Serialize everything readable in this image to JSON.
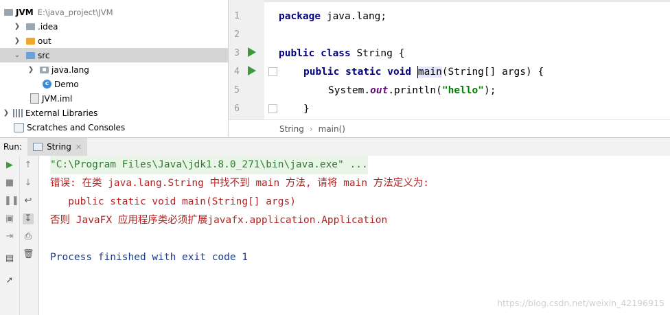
{
  "project_tree": {
    "root_name": "JVM",
    "root_path": "E:\\java_project\\JVM",
    "items": [
      {
        "label": ".idea"
      },
      {
        "label": "out"
      },
      {
        "label": "src"
      },
      {
        "label": "java.lang"
      },
      {
        "label": "Demo"
      },
      {
        "label": "JVM.iml"
      },
      {
        "label": "External Libraries"
      },
      {
        "label": "Scratches and Consoles"
      }
    ]
  },
  "editor": {
    "line_numbers": [
      "1",
      "2",
      "3",
      "4",
      "5",
      "6"
    ],
    "code": {
      "l1_kw": "package",
      "l1_rest": " java.lang;",
      "l3_kw": "public class",
      "l3_rest": " String {",
      "l4_kw": "public static void",
      "l4_method": "main",
      "l4_rest": "(String[] args) {",
      "l5_pre": "System.",
      "l5_field": "out",
      "l5_mid": ".println(",
      "l5_str": "\"hello\"",
      "l5_end": ");",
      "l6": "}"
    },
    "breadcrumbs": [
      "String",
      "main()"
    ]
  },
  "run_window": {
    "label": "Run:",
    "tab_title": "String",
    "console": {
      "cmd": "\"C:\\Program Files\\Java\\jdk1.8.0_271\\bin\\java.exe\" ...",
      "err1": "错误: 在类 java.lang.String 中找不到 main 方法, 请将 main 方法定义为:",
      "err2": "   public static void main(String[] args)",
      "err3": "否则 JavaFX 应用程序类必须扩展javafx.application.Application",
      "finish": "Process finished with exit code 1"
    }
  },
  "watermark": "https://blog.csdn.net/weixin_42196915"
}
